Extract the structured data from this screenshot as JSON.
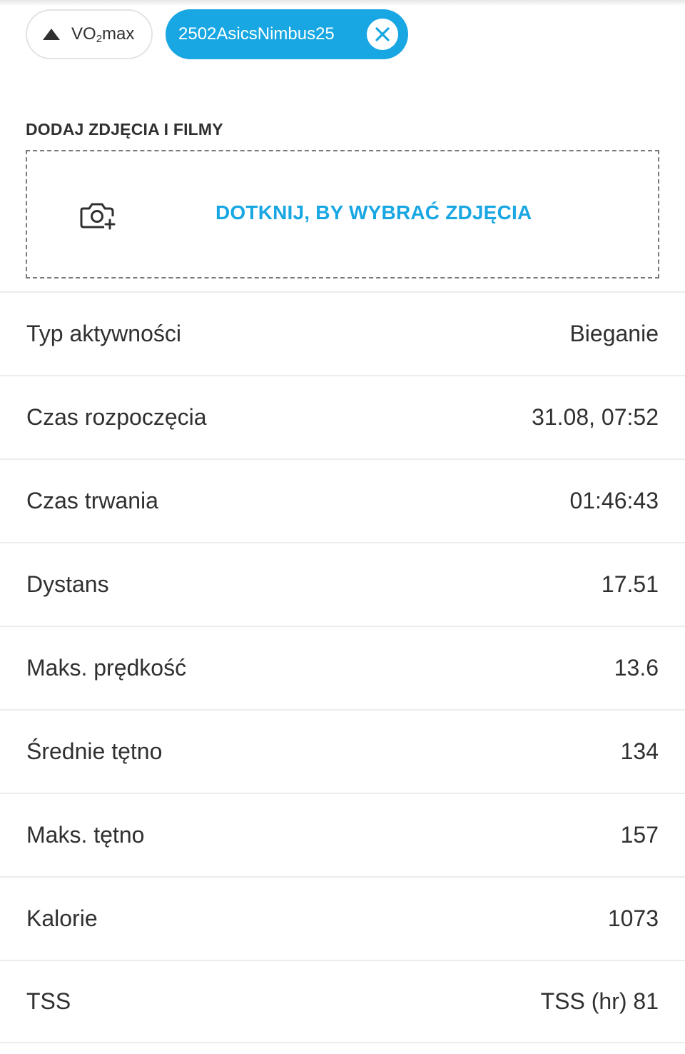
{
  "chips": {
    "vo2": {
      "prefix": "VO",
      "sub": "2",
      "suffix": "max"
    },
    "tag": {
      "label": "2502AsicsNimbus25"
    }
  },
  "media": {
    "section_title": "DODAJ ZDJĘCIA I FILMY",
    "upload_label": "DOTKNIJ, BY WYBRAĆ ZDJĘCIA",
    "icon": "camera-add-icon"
  },
  "details": [
    {
      "label": "Typ aktywności",
      "value": "Bieganie"
    },
    {
      "label": "Czas rozpoczęcia",
      "value": "31.08, 07:52"
    },
    {
      "label": "Czas trwania",
      "value": "01:46:43"
    },
    {
      "label": "Dystans",
      "value": "17.51"
    },
    {
      "label": "Maks. prędkość",
      "value": "13.6"
    },
    {
      "label": "Średnie tętno",
      "value": "134"
    },
    {
      "label": "Maks. tętno",
      "value": "157"
    },
    {
      "label": "Kalorie",
      "value": "1073"
    },
    {
      "label": "TSS",
      "value": "TSS (hr) 81"
    }
  ],
  "colors": {
    "accent": "#18a7e3",
    "text": "#303030",
    "divider": "#ececec"
  }
}
